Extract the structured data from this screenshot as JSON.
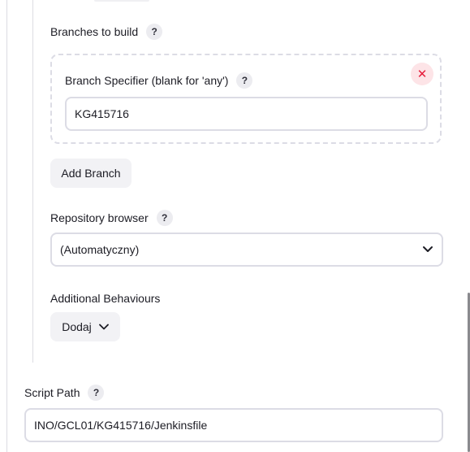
{
  "branches_section": {
    "label": "Branches to build",
    "help": "?"
  },
  "branch_card": {
    "specifier_label": "Branch Specifier (blank for 'any')",
    "help": "?",
    "remove_symbol": "✕",
    "value": "KG415716"
  },
  "add_branch_button": "Add Branch",
  "repository_browser": {
    "label": "Repository browser",
    "help": "?",
    "selected": "(Automatyczny)"
  },
  "additional_behaviours": {
    "label": "Additional Behaviours",
    "add_button": "Dodaj"
  },
  "script_path": {
    "label": "Script Path",
    "help": "?",
    "value": "INO/GCL01/KG415716/Jenkinsfile"
  },
  "colors": {
    "remove_icon": "#e61e3c",
    "remove_bg": "#fde4e7",
    "border": "#dcdce5"
  }
}
